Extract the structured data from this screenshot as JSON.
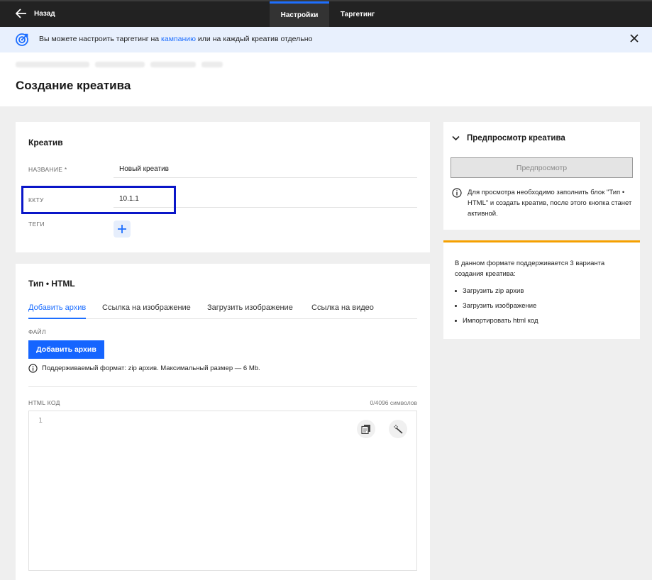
{
  "topbar": {
    "back_label": "Назад",
    "tabs": [
      {
        "label": "Настройки",
        "active": true
      },
      {
        "label": "Таргетинг",
        "active": false
      }
    ],
    "accent_color": "#1e6fff"
  },
  "banner": {
    "text_before": "Вы можете настроить таргетинг на ",
    "link_text": "кампанию",
    "text_after": " или на каждый креатив отдельно",
    "icon": "target-icon",
    "close_icon": "close-icon"
  },
  "page": {
    "title": "Создание креатива"
  },
  "creative": {
    "title": "Креатив",
    "fields": [
      {
        "label": "НАЗВАНИЕ *",
        "value": "Новый креатив"
      },
      {
        "label": "ККТУ",
        "value": "10.1.1"
      },
      {
        "label": "ТЕГИ",
        "value": ""
      }
    ],
    "add_tag_icon": "plus-icon"
  },
  "type_card": {
    "title": "Тип • HTML",
    "tabs": [
      {
        "label": "Добавить архив",
        "active": true
      },
      {
        "label": "Ссылка на изображение",
        "active": false
      },
      {
        "label": "Загрузить изображение",
        "active": false
      },
      {
        "label": "Ссылка на видео",
        "active": false
      }
    ],
    "file_label": "ФАЙЛ",
    "add_archive_button": "Добавить архив",
    "hint": "Поддерживаемый формат: zip архив. Максимальный размер — 6 Mb.",
    "html_code_label": "HTML КОД",
    "counter": "0/4096 символов",
    "editor_line": "1",
    "copy_icon": "copy-icon",
    "magic_icon": "magic-wand-icon"
  },
  "preview": {
    "title": "Предпросмотр креатива",
    "button": "Предпросмотр",
    "note": "Для просмотра необходимо заполнить блок \"Тип • HTML\" и создать креатив, после этого кнопка станет активной.",
    "chevron_icon": "chevron-down-icon",
    "info_icon": "info-icon"
  },
  "info": {
    "text": "В данном формате поддерживается 3 варианта создания креатива:",
    "items": [
      "Загрузить zip архив",
      "Загрузить изображение",
      "Импортировать html код"
    ],
    "accent_color": "#f5a000"
  }
}
